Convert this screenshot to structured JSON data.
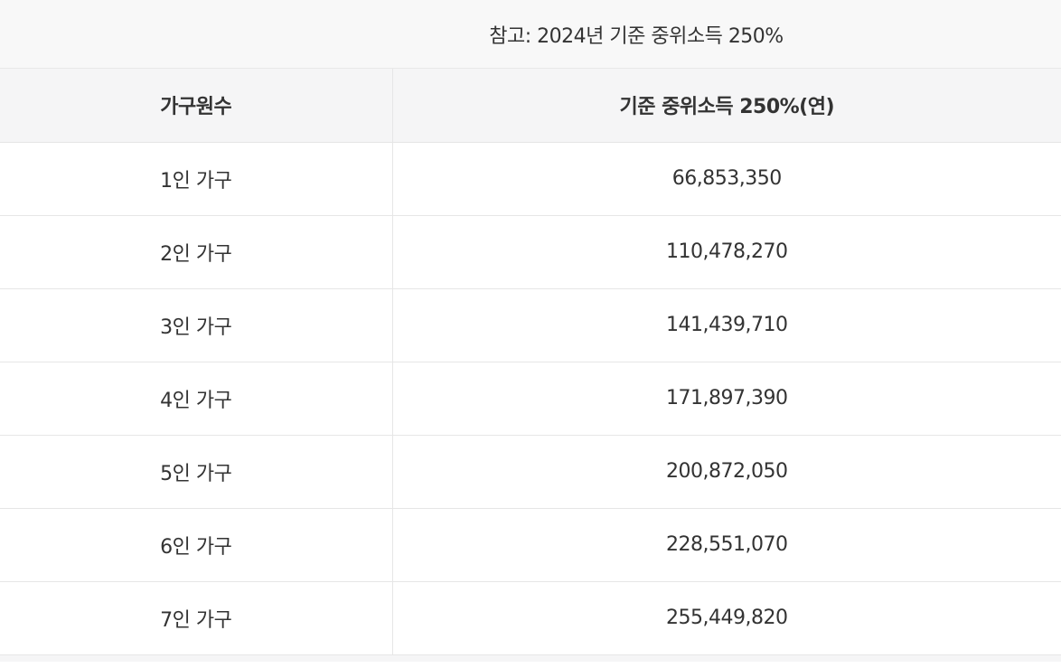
{
  "caption": "참고: 2024년 기준 중위소득 250%",
  "headers": {
    "household": "가구원수",
    "income": "기준 중위소득 250%(연)"
  },
  "rows": [
    {
      "household": "1인 가구",
      "income": "66,853,350"
    },
    {
      "household": "2인 가구",
      "income": "110,478,270"
    },
    {
      "household": "3인 가구",
      "income": "141,439,710"
    },
    {
      "household": "4인 가구",
      "income": "171,897,390"
    },
    {
      "household": "5인 가구",
      "income": "200,872,050"
    },
    {
      "household": "6인 가구",
      "income": "228,551,070"
    },
    {
      "household": "7인 가구",
      "income": "255,449,820"
    }
  ]
}
